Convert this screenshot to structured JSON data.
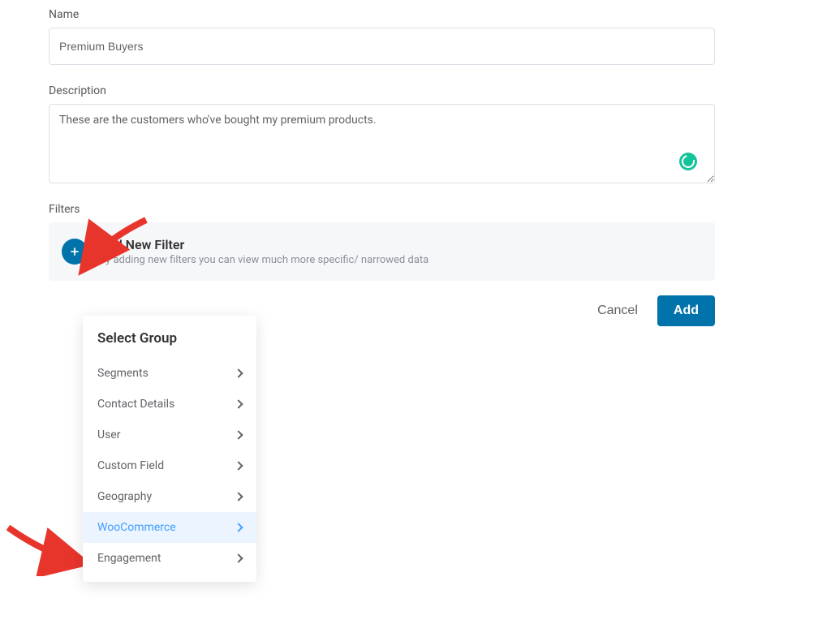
{
  "form": {
    "name_label": "Name",
    "name_value": "Premium Buyers",
    "desc_label": "Description",
    "desc_value": "These are the customers who've bought my premium products.",
    "filters_label": "Filters",
    "add_filter_title": "Add New Filter",
    "add_filter_sub": "By adding new filters you can view much more specific/ narrowed data"
  },
  "actions": {
    "cancel": "Cancel",
    "add": "Add"
  },
  "dropdown": {
    "title": "Select Group",
    "items": [
      {
        "label": "Segments",
        "hovered": false
      },
      {
        "label": "Contact Details",
        "hovered": false
      },
      {
        "label": "User",
        "hovered": false
      },
      {
        "label": "Custom Field",
        "hovered": false
      },
      {
        "label": "Geography",
        "hovered": false
      },
      {
        "label": "WooCommerce",
        "hovered": true
      },
      {
        "label": "Engagement",
        "hovered": false
      }
    ]
  }
}
